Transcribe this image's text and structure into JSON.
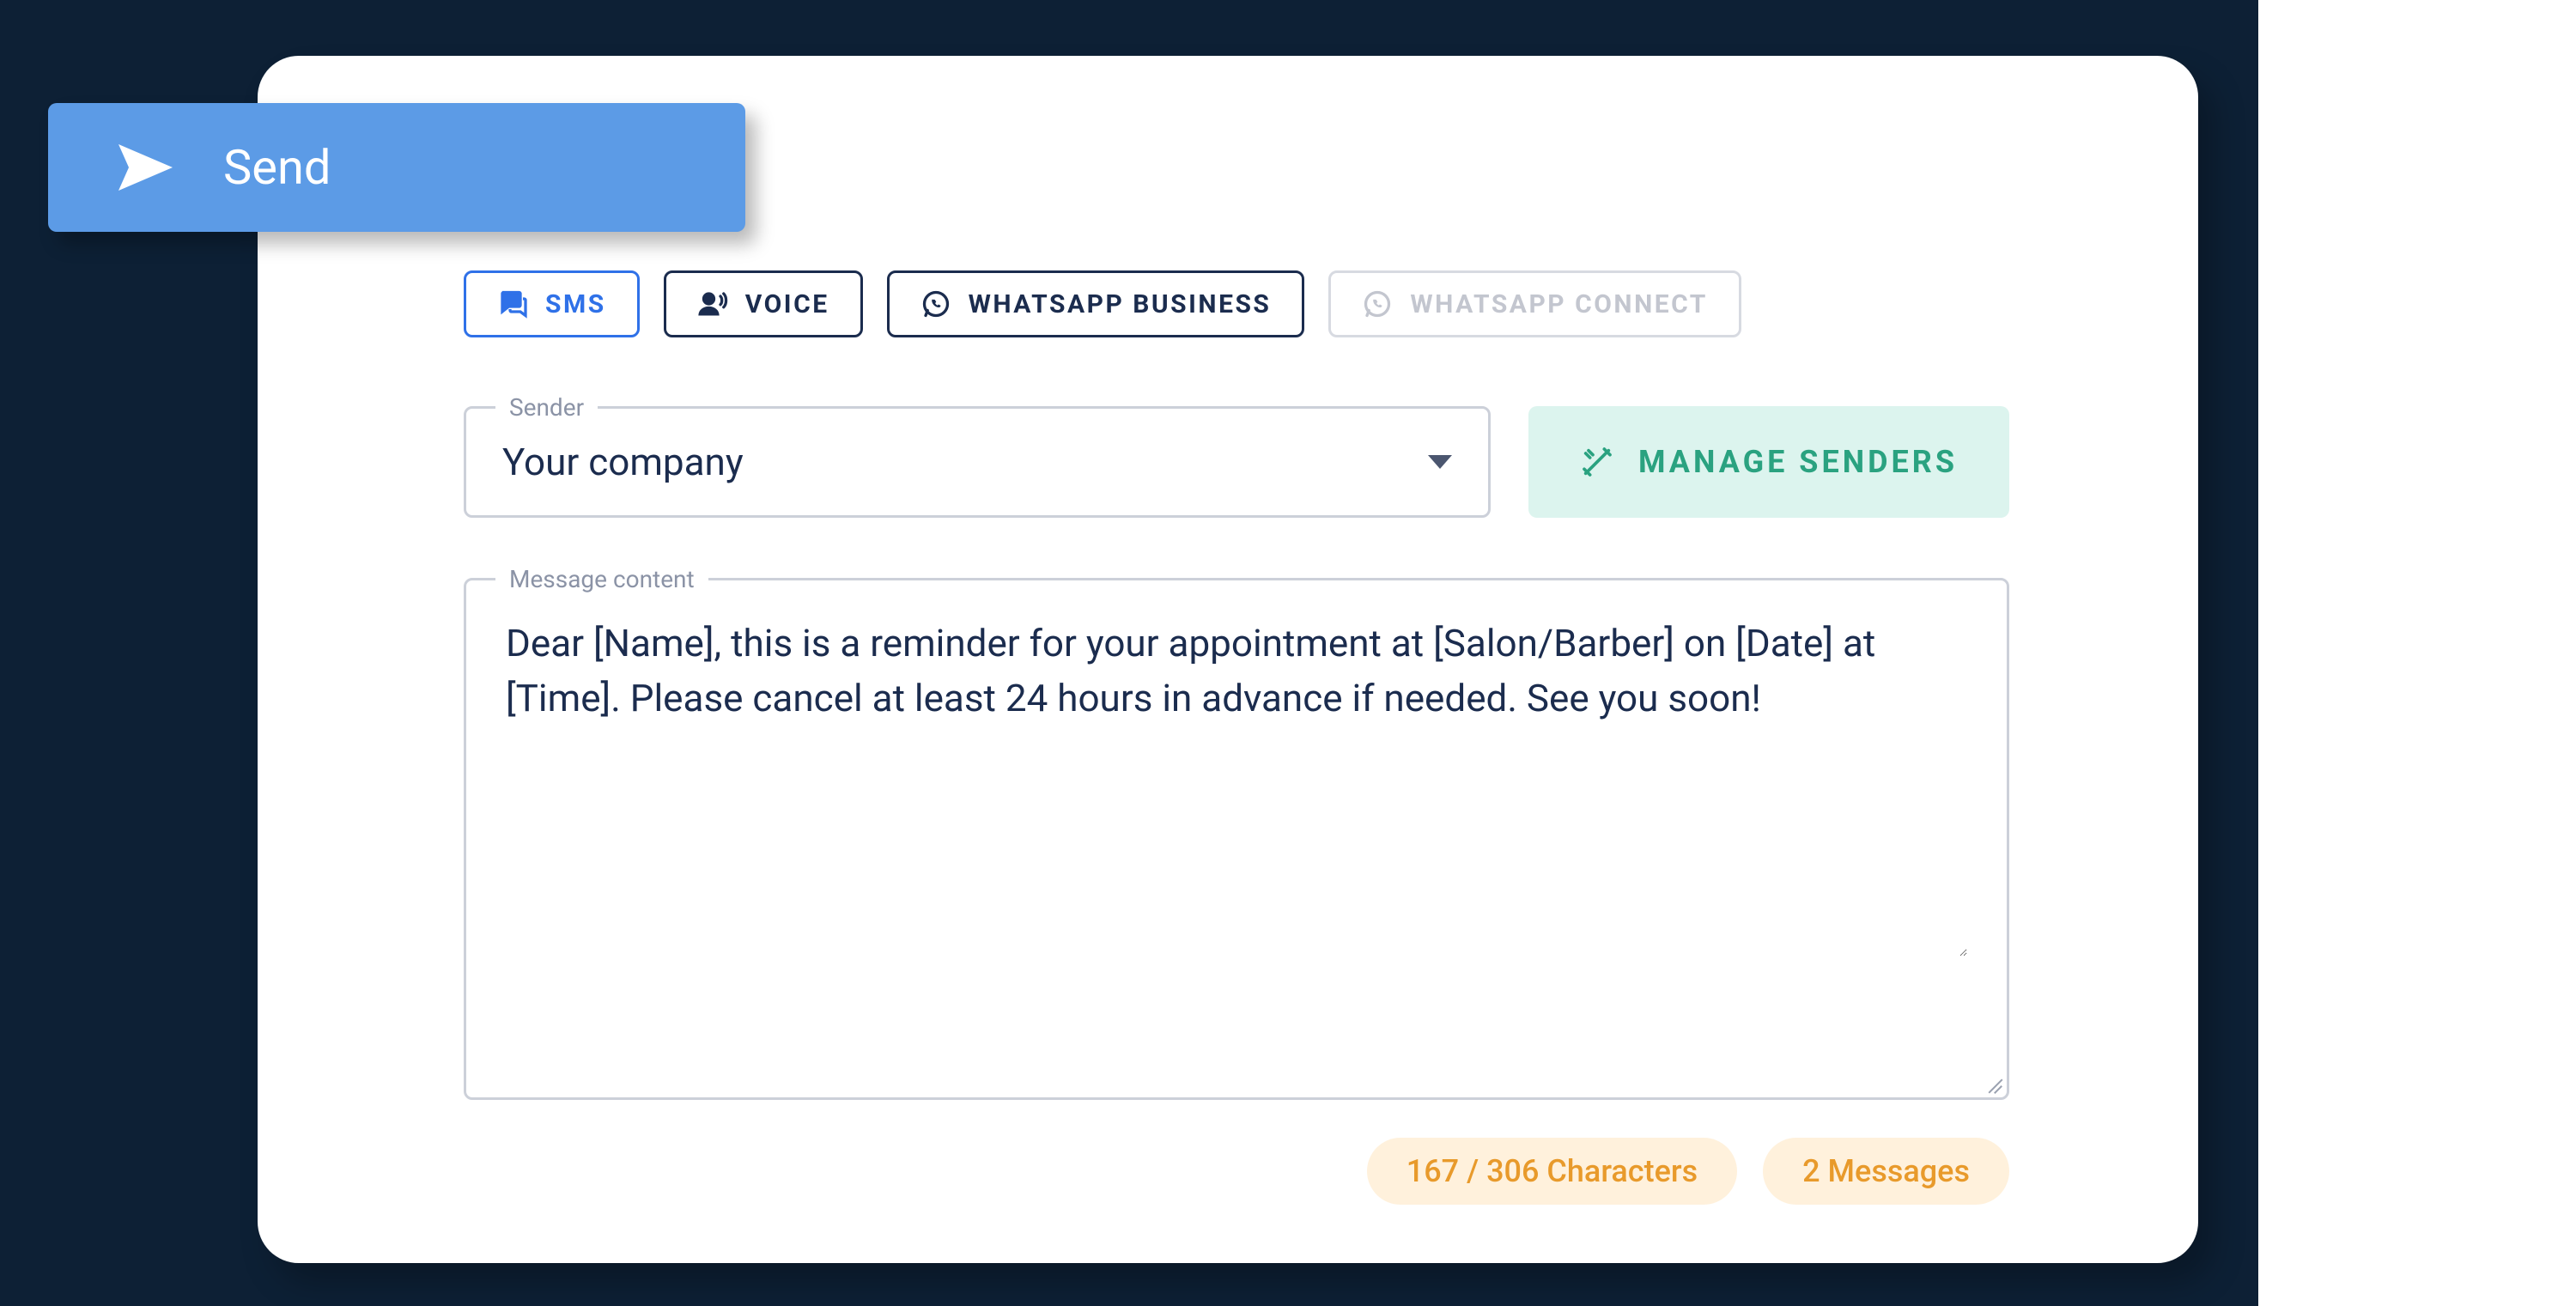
{
  "send_button": {
    "label": "Send"
  },
  "tabs": {
    "sms": "SMS",
    "voice": "VOICE",
    "whatsapp_business": "WHATSAPP BUSINESS",
    "whatsapp_connect": "WHATSAPP CONNECT"
  },
  "sender": {
    "legend": "Sender",
    "value": "Your company"
  },
  "manage_senders": {
    "label": "MANAGE SENDERS"
  },
  "message": {
    "legend": "Message content",
    "text": "Dear [Name], this is a reminder for your appointment at [Salon/Barber] on [Date] at [Time]. Please cancel at least 24 hours in advance if needed. See you soon!"
  },
  "status": {
    "characters": "167 / 306 Characters",
    "messages": "2 Messages"
  }
}
